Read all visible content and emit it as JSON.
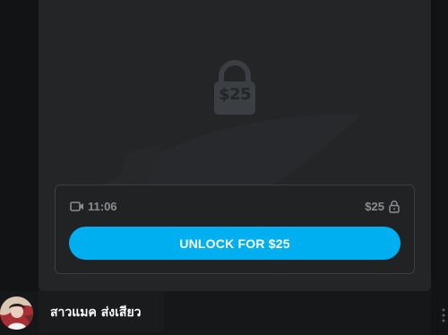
{
  "locked_post": {
    "lock_price": "$25",
    "duration": "11:06",
    "price": "$25",
    "unlock_label": "UNLOCK FOR $25"
  },
  "author": {
    "name": "สาวแมค ส่งเสียว"
  },
  "colors": {
    "accent": "#00aff0",
    "card_bg": "#232527",
    "muted_text": "#8a8d91"
  },
  "icons": {
    "lock": "lock-icon",
    "video": "video-icon",
    "price_lock": "small-lock-icon",
    "more": "more-vertical-icon"
  }
}
